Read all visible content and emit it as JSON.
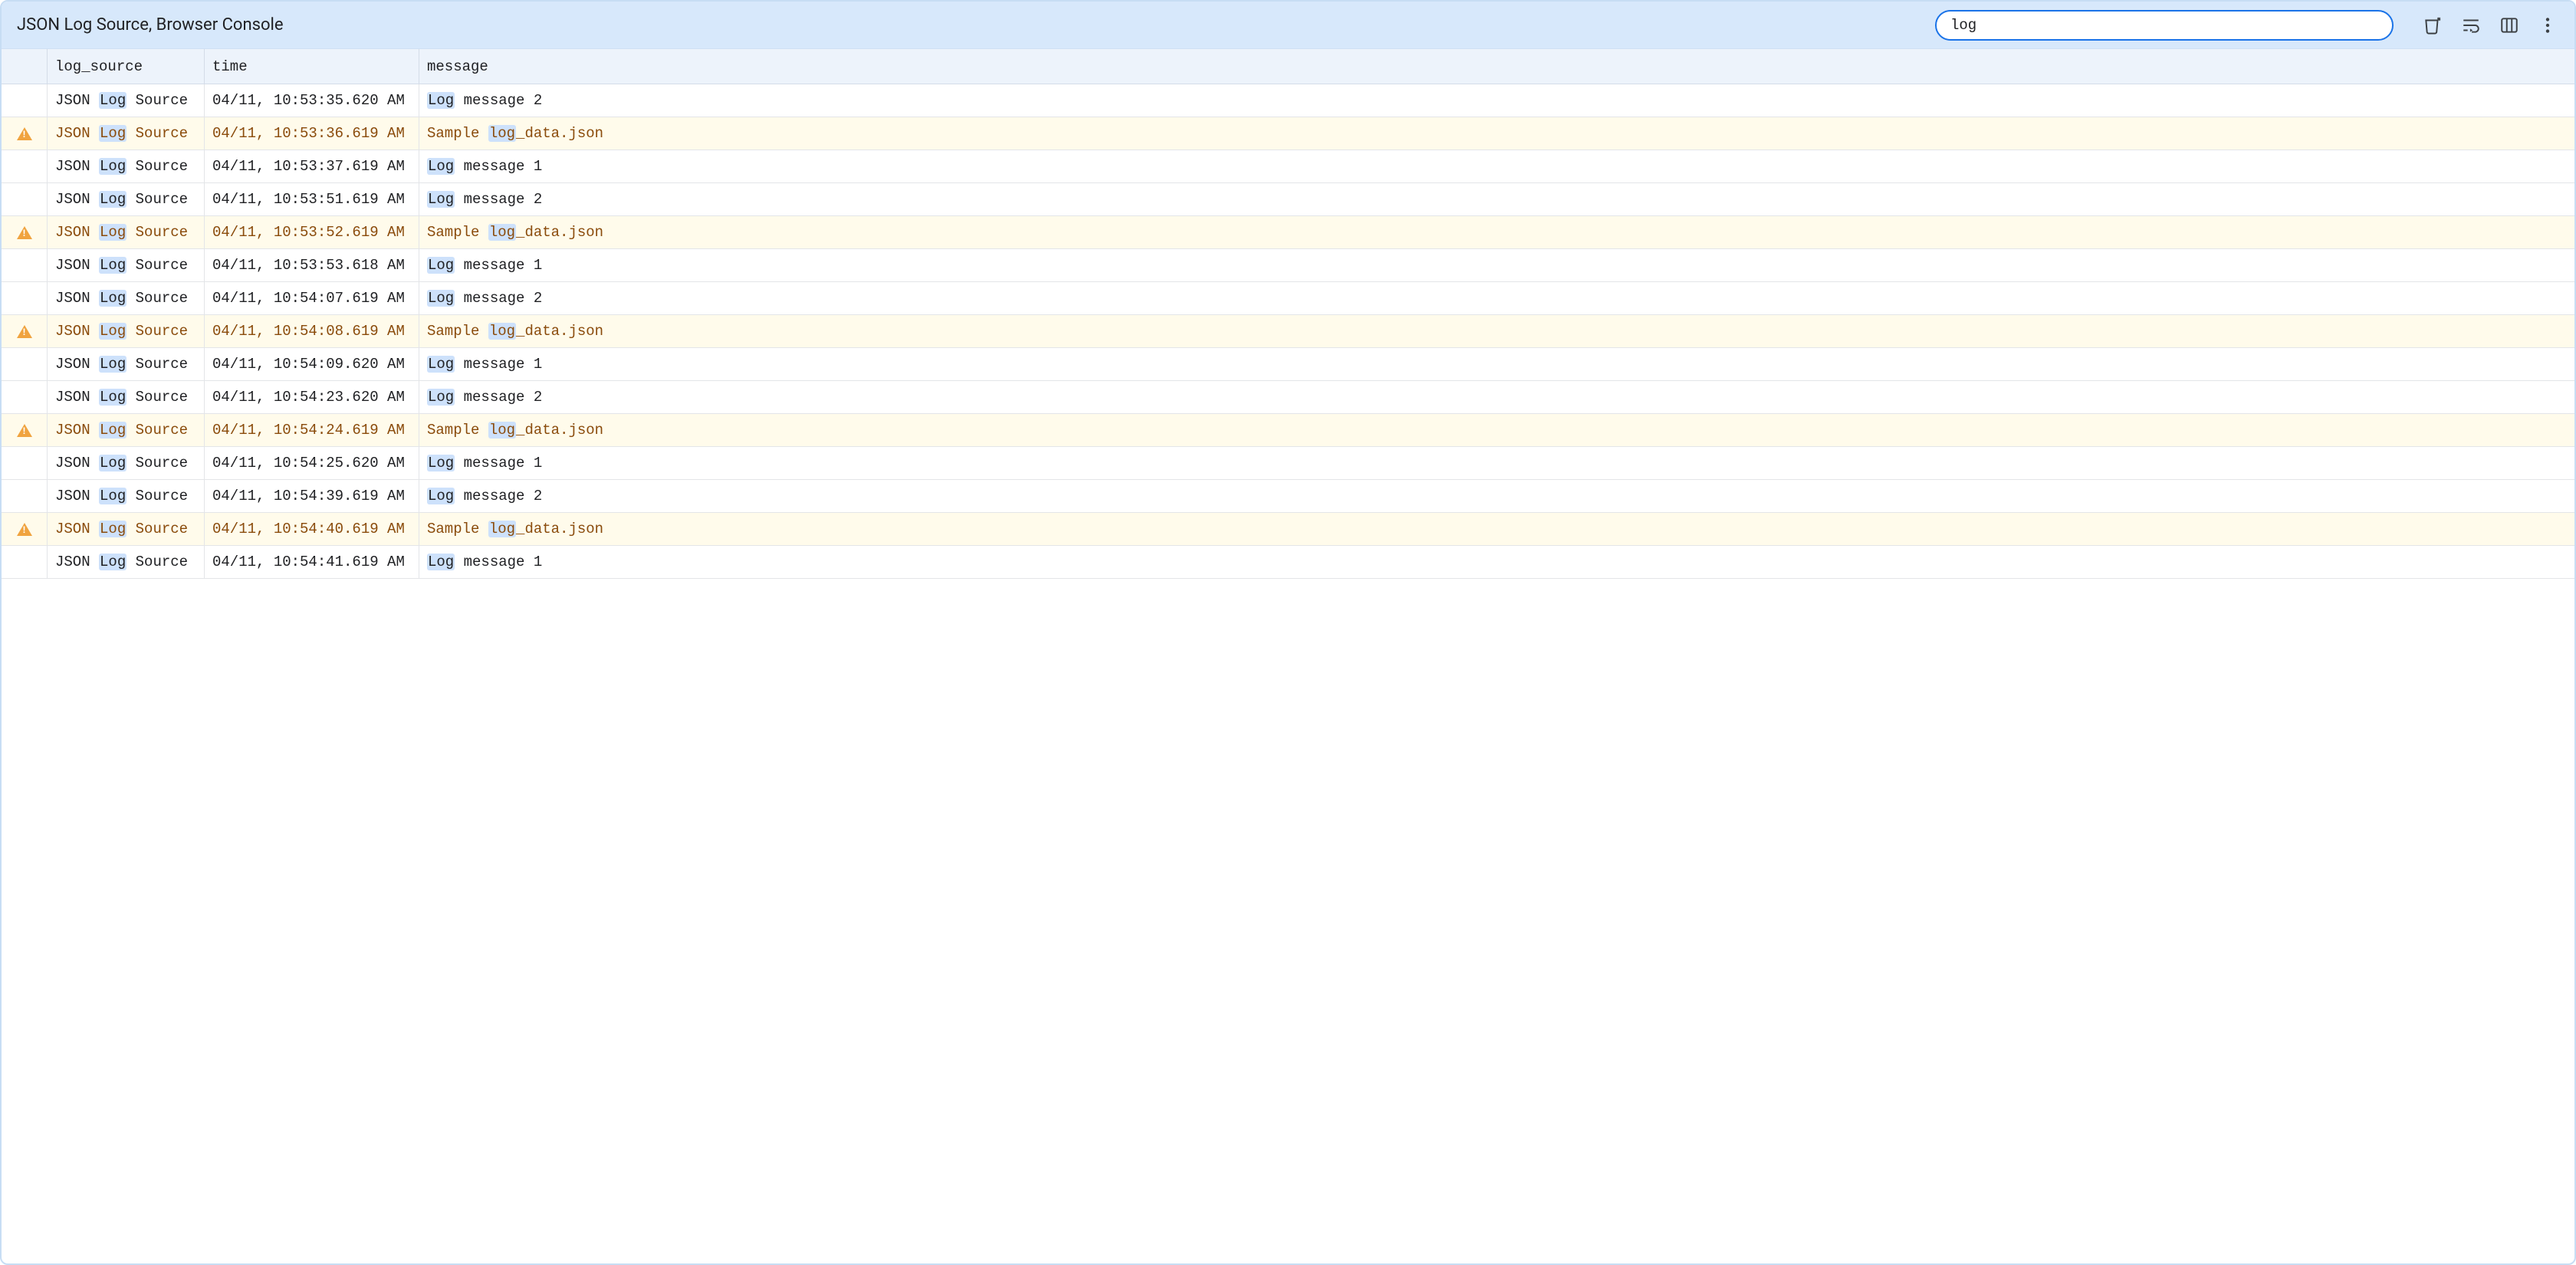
{
  "toolbar": {
    "title": "JSON Log Source, Browser Console",
    "search_value": "log",
    "search_placeholder": ""
  },
  "columns": {
    "icon": "",
    "log_source": "log_source",
    "time": "time",
    "message": "message"
  },
  "highlight_term": "log",
  "rows": [
    {
      "level": "info",
      "log_source": "JSON Log Source",
      "time": "04/11, 10:53:35.620 AM",
      "message": "Log message 2"
    },
    {
      "level": "warning",
      "log_source": "JSON Log Source",
      "time": "04/11, 10:53:36.619 AM",
      "message": "Sample log_data.json"
    },
    {
      "level": "info",
      "log_source": "JSON Log Source",
      "time": "04/11, 10:53:37.619 AM",
      "message": "Log message 1"
    },
    {
      "level": "info",
      "log_source": "JSON Log Source",
      "time": "04/11, 10:53:51.619 AM",
      "message": "Log message 2"
    },
    {
      "level": "warning",
      "log_source": "JSON Log Source",
      "time": "04/11, 10:53:52.619 AM",
      "message": "Sample log_data.json"
    },
    {
      "level": "info",
      "log_source": "JSON Log Source",
      "time": "04/11, 10:53:53.618 AM",
      "message": "Log message 1"
    },
    {
      "level": "info",
      "log_source": "JSON Log Source",
      "time": "04/11, 10:54:07.619 AM",
      "message": "Log message 2"
    },
    {
      "level": "warning",
      "log_source": "JSON Log Source",
      "time": "04/11, 10:54:08.619 AM",
      "message": "Sample log_data.json"
    },
    {
      "level": "info",
      "log_source": "JSON Log Source",
      "time": "04/11, 10:54:09.620 AM",
      "message": "Log message 1"
    },
    {
      "level": "info",
      "log_source": "JSON Log Source",
      "time": "04/11, 10:54:23.620 AM",
      "message": "Log message 2"
    },
    {
      "level": "warning",
      "log_source": "JSON Log Source",
      "time": "04/11, 10:54:24.619 AM",
      "message": "Sample log_data.json"
    },
    {
      "level": "info",
      "log_source": "JSON Log Source",
      "time": "04/11, 10:54:25.620 AM",
      "message": "Log message 1"
    },
    {
      "level": "info",
      "log_source": "JSON Log Source",
      "time": "04/11, 10:54:39.619 AM",
      "message": "Log message 2"
    },
    {
      "level": "warning",
      "log_source": "JSON Log Source",
      "time": "04/11, 10:54:40.619 AM",
      "message": "Sample log_data.json"
    },
    {
      "level": "info",
      "log_source": "JSON Log Source",
      "time": "04/11, 10:54:41.619 AM",
      "message": "Log message 1"
    }
  ]
}
